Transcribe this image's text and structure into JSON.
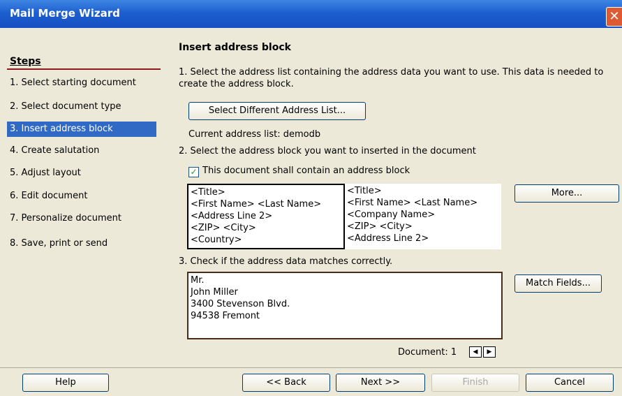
{
  "window": {
    "title": "Mail Merge Wizard",
    "close_glyph": "✕"
  },
  "steps": {
    "title": "Steps",
    "items": [
      "1.  Select starting document",
      "2.  Select document type",
      "3.  Insert address block",
      "4.  Create salutation",
      "5.  Adjust layout",
      "6.  Edit document",
      "7.  Personalize document",
      "8.  Save, print or send"
    ],
    "selected_index": 2
  },
  "main": {
    "heading": "Insert address block",
    "step1_text_line1": "1. Select the address list containing the address data you want to use. This data is needed to",
    "step1_text_line2": "create the address block.",
    "select_list_button": "Select Different Address List...",
    "current_list": "Current address list: demodb",
    "step2_text": "2. Select the address block you want to inserted in the document",
    "checkbox_label": "This document shall contain an address block",
    "checkbox_checked": true,
    "block1": [
      "<Title>",
      "<First Name> <Last Name>",
      "<Address Line 2>",
      "<ZIP> <City>",
      "<Country>"
    ],
    "block2": [
      "<Title>",
      "<First Name> <Last Name>",
      "<Company Name>",
      "<ZIP> <City>",
      "<Address Line 2>"
    ],
    "more_button": "More...",
    "step3_text": "3. Check if the address data matches correctly.",
    "preview": [
      "Mr.",
      "John Miller",
      "3400 Stevenson Blvd.",
      "94538 Fremont"
    ],
    "match_fields_button": "Match Fields...",
    "document_label": "Document: 1"
  },
  "footer": {
    "help": "Help",
    "back": "<< Back",
    "next": "Next >>",
    "finish": "Finish",
    "cancel": "Cancel"
  },
  "colors": {
    "title_bar": "#1d5fcf",
    "selection": "#316ac5",
    "background": "#ece9d8"
  }
}
